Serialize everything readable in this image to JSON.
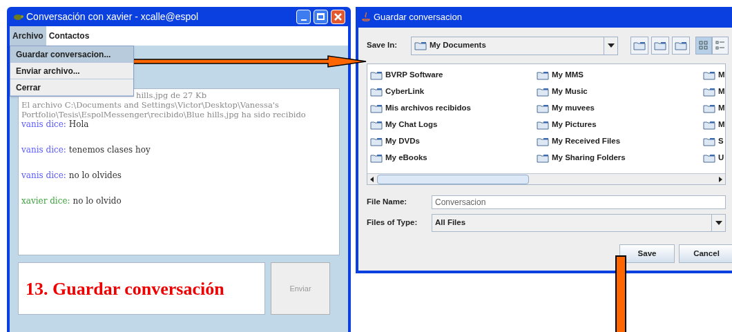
{
  "chat_window": {
    "title": "Conversación con xavier - xcalle@espol",
    "menu": [
      {
        "label": "Archivo",
        "selected": true
      },
      {
        "label": "Contactos",
        "selected": false
      }
    ],
    "dropdown": [
      {
        "label": "Guardar conversacion...",
        "selected": true
      },
      {
        "label": "Enviar archivo...",
        "selected": false
      },
      {
        "label": "Cerrar",
        "selected": false
      }
    ],
    "log": [
      {
        "kind": "system",
        "text": "hills.jpg de 27 Kb"
      },
      {
        "kind": "system",
        "text": "El archivo C:\\Documents and Settings\\Victor\\Desktop\\Vanessa's Portfolio\\Tesis\\EspolMessenger\\recibido\\Blue hills.jpg ha sido recibido"
      },
      {
        "kind": "message",
        "sender": "vanis dice:",
        "text": "Hola",
        "color": "#5a5aff"
      },
      {
        "kind": "message",
        "sender": "vanis dice:",
        "text": "tenemos clases hoy",
        "color": "#5a5aff"
      },
      {
        "kind": "message",
        "sender": "vanis dice:",
        "text": "no lo olvides",
        "color": "#5a5aff"
      },
      {
        "kind": "message",
        "sender": "xavier dice:",
        "text": "no lo olvido",
        "color": "#3fa33f"
      }
    ],
    "caption": "13. Guardar conversación",
    "send_button": {
      "label": "Enviar",
      "disabled": true
    }
  },
  "save_dialog": {
    "title": "Guardar conversacion",
    "save_in_label": "Save In:",
    "save_in_value": "My Documents",
    "view_modes": [
      {
        "selected": true
      },
      {
        "selected": false
      }
    ],
    "folder_columns": [
      [
        "BVRP Software",
        "CyberLink",
        "Mis archivos recibidos",
        "My Chat Logs",
        "My DVDs",
        "My eBooks"
      ],
      [
        "My MMS",
        "My Music",
        "My muvees",
        "My Pictures",
        "My Received Files",
        "My Sharing Folders"
      ],
      [
        "M",
        "M",
        "M",
        "M",
        "S",
        "U"
      ]
    ],
    "file_name_label": "File Name:",
    "file_name_value": "Conversacion",
    "file_type_label": "Files of Type:",
    "file_type_value": "All Files",
    "buttons": [
      "Save",
      "Cancel"
    ]
  }
}
